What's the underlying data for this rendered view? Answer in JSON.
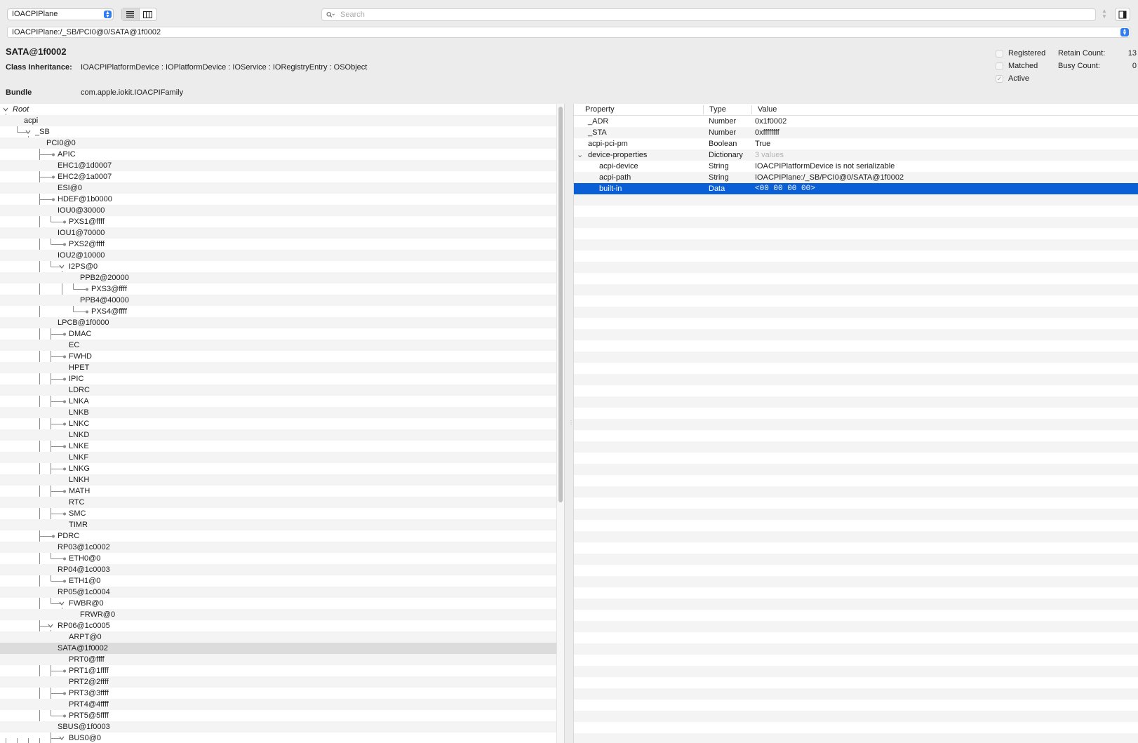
{
  "toolbar": {
    "plane": "IOACPIPlane",
    "search_placeholder": "Search"
  },
  "path": "IOACPIPlane:/_SB/PCI0@0/SATA@1f0002",
  "info": {
    "title": "SATA@1f0002",
    "inheritance_label": "Class Inheritance:",
    "inheritance": "IOACPIPlatformDevice : IOPlatformDevice : IOService : IORegistryEntry : OSObject",
    "bundle_label": "Bundle",
    "bundle": "com.apple.iokit.IOACPIFamily",
    "flags": [
      {
        "label": "Registered",
        "checked": false
      },
      {
        "label": "Matched",
        "checked": false
      },
      {
        "label": "Active",
        "checked": true
      }
    ],
    "counts": [
      {
        "label": "Retain Count:",
        "value": "13"
      },
      {
        "label": "Busy Count:",
        "value": "0"
      }
    ]
  },
  "tree": [
    {
      "label": "Root",
      "depth": 0,
      "expanded": true,
      "italic": true
    },
    {
      "label": "acpi",
      "depth": 1,
      "expanded": true
    },
    {
      "label": "_SB",
      "depth": 2,
      "expanded": true
    },
    {
      "label": "PCI0@0",
      "depth": 3,
      "expanded": true
    },
    {
      "label": "APIC",
      "depth": 4
    },
    {
      "label": "EHC1@1d0007",
      "depth": 4
    },
    {
      "label": "EHC2@1a0007",
      "depth": 4
    },
    {
      "label": "ESI@0",
      "depth": 4
    },
    {
      "label": "HDEF@1b0000",
      "depth": 4
    },
    {
      "label": "IOU0@30000",
      "depth": 4,
      "expanded": true
    },
    {
      "label": "PXS1@ffff",
      "depth": 5
    },
    {
      "label": "IOU1@70000",
      "depth": 4,
      "expanded": true
    },
    {
      "label": "PXS2@ffff",
      "depth": 5
    },
    {
      "label": "IOU2@10000",
      "depth": 4,
      "expanded": true
    },
    {
      "label": "I2PS@0",
      "depth": 5,
      "expanded": true
    },
    {
      "label": "PPB2@20000",
      "depth": 6,
      "expanded": true
    },
    {
      "label": "PXS3@ffff",
      "depth": 7
    },
    {
      "label": "PPB4@40000",
      "depth": 6,
      "expanded": true
    },
    {
      "label": "PXS4@ffff",
      "depth": 7
    },
    {
      "label": "LPCB@1f0000",
      "depth": 4,
      "expanded": true
    },
    {
      "label": "DMAC",
      "depth": 5
    },
    {
      "label": "EC",
      "depth": 5
    },
    {
      "label": "FWHD",
      "depth": 5
    },
    {
      "label": "HPET",
      "depth": 5
    },
    {
      "label": "IPIC",
      "depth": 5
    },
    {
      "label": "LDRC",
      "depth": 5
    },
    {
      "label": "LNKA",
      "depth": 5
    },
    {
      "label": "LNKB",
      "depth": 5
    },
    {
      "label": "LNKC",
      "depth": 5
    },
    {
      "label": "LNKD",
      "depth": 5
    },
    {
      "label": "LNKE",
      "depth": 5
    },
    {
      "label": "LNKF",
      "depth": 5
    },
    {
      "label": "LNKG",
      "depth": 5
    },
    {
      "label": "LNKH",
      "depth": 5
    },
    {
      "label": "MATH",
      "depth": 5
    },
    {
      "label": "RTC",
      "depth": 5
    },
    {
      "label": "SMC",
      "depth": 5
    },
    {
      "label": "TIMR",
      "depth": 5
    },
    {
      "label": "PDRC",
      "depth": 4
    },
    {
      "label": "RP03@1c0002",
      "depth": 4,
      "expanded": true
    },
    {
      "label": "ETH0@0",
      "depth": 5
    },
    {
      "label": "RP04@1c0003",
      "depth": 4,
      "expanded": true
    },
    {
      "label": "ETH1@0",
      "depth": 5
    },
    {
      "label": "RP05@1c0004",
      "depth": 4,
      "expanded": true
    },
    {
      "label": "FWBR@0",
      "depth": 5,
      "expanded": true
    },
    {
      "label": "FRWR@0",
      "depth": 6
    },
    {
      "label": "RP06@1c0005",
      "depth": 4,
      "expanded": true
    },
    {
      "label": "ARPT@0",
      "depth": 5
    },
    {
      "label": "SATA@1f0002",
      "depth": 4,
      "expanded": true,
      "selected": true
    },
    {
      "label": "PRT0@ffff",
      "depth": 5
    },
    {
      "label": "PRT1@1ffff",
      "depth": 5
    },
    {
      "label": "PRT2@2ffff",
      "depth": 5
    },
    {
      "label": "PRT3@3ffff",
      "depth": 5
    },
    {
      "label": "PRT4@4ffff",
      "depth": 5
    },
    {
      "label": "PRT5@5ffff",
      "depth": 5
    },
    {
      "label": "SBUS@1f0003",
      "depth": 4,
      "expanded": true
    },
    {
      "label": "BUS0@0",
      "depth": 5,
      "expanded": true
    }
  ],
  "properties": {
    "headers": [
      "Property",
      "Type",
      "Value"
    ],
    "rows": [
      {
        "name": "_ADR",
        "type": "Number",
        "value": "0x1f0002",
        "depth": 0
      },
      {
        "name": "_STA",
        "type": "Number",
        "value": "0xffffffff",
        "depth": 0
      },
      {
        "name": "acpi-pci-pm",
        "type": "Boolean",
        "value": "True",
        "depth": 0
      },
      {
        "name": "device-properties",
        "type": "Dictionary",
        "value": "3 values",
        "depth": 0,
        "expanded": true,
        "muted": true
      },
      {
        "name": "acpi-device",
        "type": "String",
        "value": "IOACPIPlatformDevice is not serializable",
        "depth": 1
      },
      {
        "name": "acpi-path",
        "type": "String",
        "value": "IOACPIPlane:/_SB/PCI0@0/SATA@1f0002",
        "depth": 1
      },
      {
        "name": "built-in",
        "type": "Data",
        "value": "<00 00 00 00>",
        "depth": 1,
        "selected": true,
        "mono": true
      }
    ]
  },
  "colors": {
    "selection": "#0a5fd7",
    "tree_selection": "#dcdcdc",
    "accent": "#2f7cf6"
  }
}
